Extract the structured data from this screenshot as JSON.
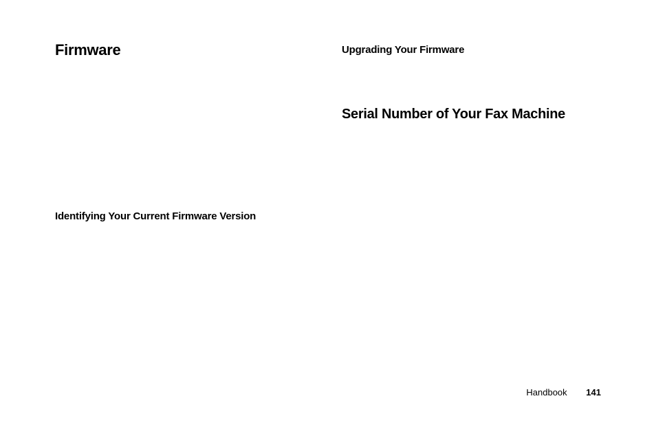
{
  "left_column": {
    "heading": "Firmware",
    "subheading": "Identifying Your Current Firmware Version"
  },
  "right_column": {
    "subheading": "Upgrading Your Firmware",
    "section_heading": "Serial Number of Your Fax Machine"
  },
  "footer": {
    "label": "Handbook",
    "page_number": "141"
  }
}
